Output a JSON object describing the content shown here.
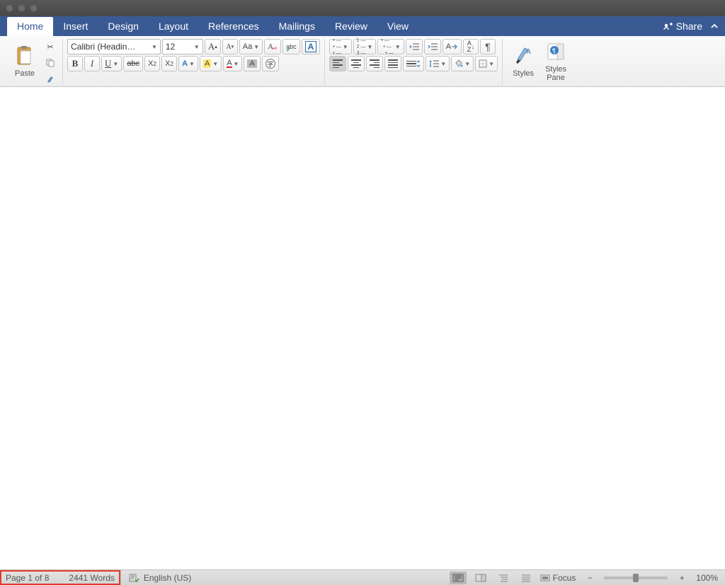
{
  "tabs": {
    "items": [
      "Home",
      "Insert",
      "Design",
      "Layout",
      "References",
      "Mailings",
      "Review",
      "View"
    ],
    "active": "Home",
    "share_label": "Share"
  },
  "clipboard": {
    "paste_label": "Paste"
  },
  "font": {
    "name": "Calibri (Headin…",
    "size": "12",
    "bold": "B",
    "italic": "I",
    "underline": "U",
    "strike": "abc",
    "sub": "X",
    "sub2": "2",
    "sup": "X",
    "sup2": "2",
    "bigA": "A",
    "smallA": "A",
    "clearA": "A",
    "aa": "Aa",
    "abc": "abc",
    "boxed_a": "A",
    "effect_a": "A",
    "highlight_a": "A",
    "color_a": "A",
    "shade_a": "A",
    "circled": "字"
  },
  "para": {
    "sort": "A",
    "sort2": "Z"
  },
  "styles": {
    "label": "Styles",
    "pane_label": "Styles\nPane"
  },
  "status": {
    "page": "Page 1 of 8",
    "words": "2441 Words",
    "language": "English (US)",
    "focus": "Focus",
    "zoom": "100%"
  }
}
